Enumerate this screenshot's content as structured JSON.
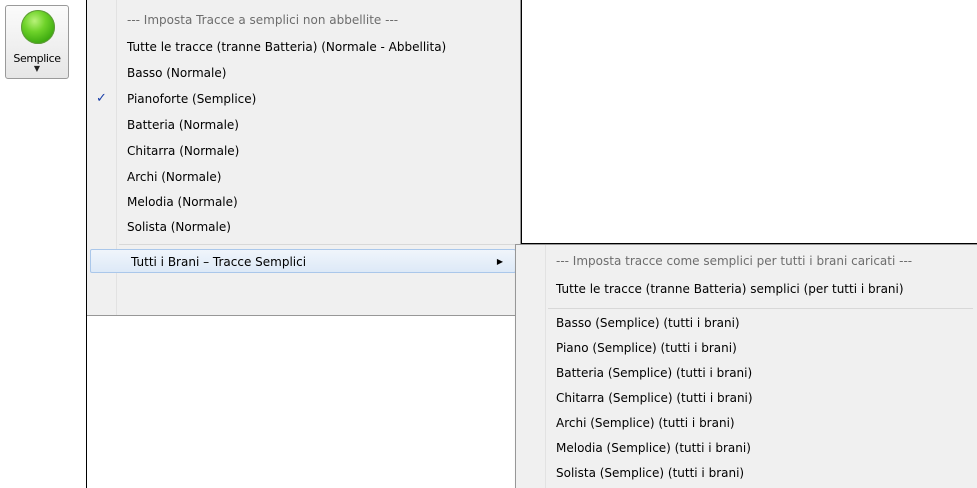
{
  "toolbar": {
    "button_label": "Semplice",
    "button_arrow": "▼",
    "indicator_color": "#4cc01a"
  },
  "menu": {
    "header": "--- Imposta Tracce a semplici non abbellite ---",
    "items": [
      {
        "label": "Tutte le tracce (tranne Batteria) (Normale - Abbellita)",
        "checked": false
      },
      {
        "label": "Basso (Normale)",
        "checked": false
      },
      {
        "label": "Pianoforte (Semplice)",
        "checked": true
      },
      {
        "label": "Batteria (Normale)",
        "checked": false
      },
      {
        "label": "Chitarra (Normale)",
        "checked": false
      },
      {
        "label": "Archi (Normale)",
        "checked": false
      },
      {
        "label": "Melodia (Normale)",
        "checked": false
      },
      {
        "label": "Solista (Normale)",
        "checked": false
      }
    ],
    "check_mark": "✓",
    "submenu_item": {
      "label": "Tutti i Brani – Tracce Semplici",
      "arrow": "▶"
    }
  },
  "submenu": {
    "header": "--- Imposta tracce come semplici per tutti i brani caricati ---",
    "all_item": "Tutte le tracce (tranne Batteria) semplici (per tutti i brani)",
    "items": [
      "Basso (Semplice) (tutti i brani)",
      "Piano (Semplice) (tutti i brani)",
      "Batteria (Semplice) (tutti i brani)",
      "Chitarra (Semplice) (tutti i brani)",
      "Archi (Semplice) (tutti i brani)",
      "Melodia (Semplice) (tutti i brani)",
      "Solista (Semplice) (tutti i brani)"
    ]
  }
}
